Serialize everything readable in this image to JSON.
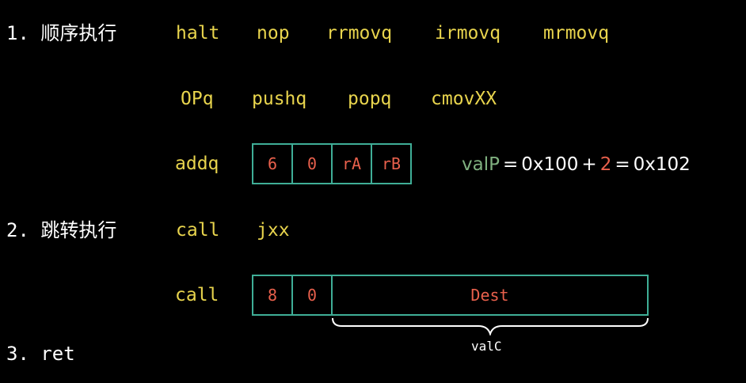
{
  "sections": [
    {
      "label": "1. 顺序执行"
    },
    {
      "label": "2. 跳转执行"
    },
    {
      "label": "3. ret"
    }
  ],
  "seq_row1": [
    "halt",
    "nop",
    "rrmovq",
    "irmovq",
    "mrmovq"
  ],
  "seq_row2": [
    "OPq",
    "pushq",
    "popq",
    "cmovXX"
  ],
  "addq": {
    "name": "addq",
    "fields": [
      "6",
      "0",
      "rA",
      "rB"
    ],
    "formula": {
      "lhs": "valP",
      "eq1": "=",
      "base": "0x100",
      "plus": "+",
      "len": "2",
      "eq2": "=",
      "result": "0x102"
    }
  },
  "jump_row": [
    "call",
    "jxx"
  ],
  "call": {
    "name": "call",
    "fields": [
      "8",
      "0",
      "Dest"
    ],
    "brace_label": "valC"
  },
  "colors": {
    "background": "#000000",
    "label": "#ffffff",
    "instruction": "#e8d44d",
    "field_text": "#e8604c",
    "field_border": "#3fae97",
    "valP": "#7fb07f"
  }
}
